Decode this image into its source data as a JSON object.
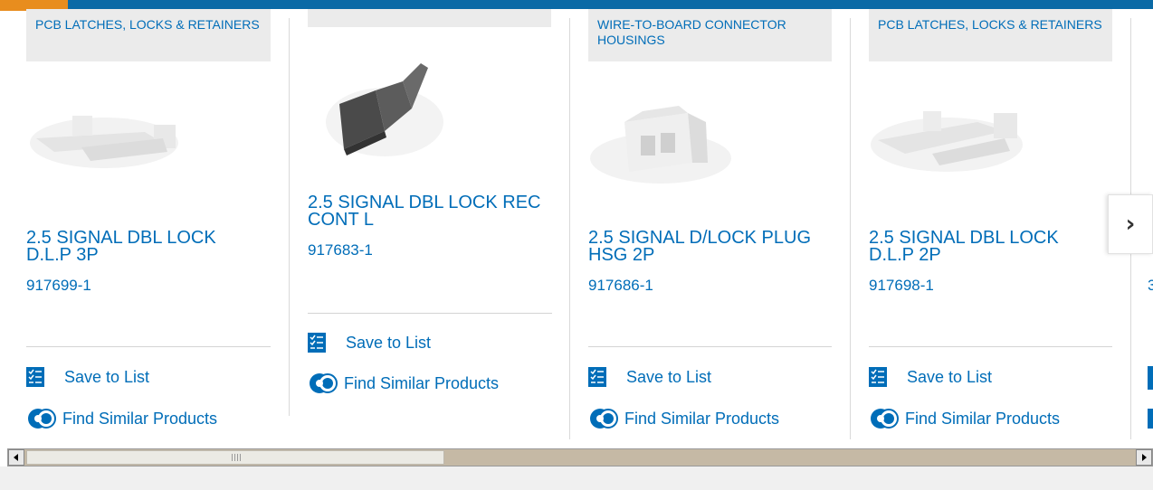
{
  "cards": [
    {
      "category": "PCB LATCHES, LOCKS & RETAINERS",
      "title": "2.5 SIGNAL DBL LOCK D.L.P 3P",
      "part_number": "917699-1",
      "save_label": "Save to List",
      "similar_label": "Find Similar Products"
    },
    {
      "category": "",
      "title": "2.5 SIGNAL DBL LOCK REC CONT L",
      "part_number": "917683-1",
      "save_label": "Save to List",
      "similar_label": "Find Similar Products"
    },
    {
      "category": "WIRE-TO-BOARD CONNECTOR HOUSINGS",
      "title": "2.5 SIGNAL D/LOCK PLUG HSG 2P",
      "part_number": "917686-1",
      "save_label": "Save to List",
      "similar_label": "Find Similar Products"
    },
    {
      "category": "PCB LATCHES, LOCKS & RETAINERS",
      "title": "2.5 SIGNAL DBL LOCK D.L.P 2P",
      "part_number": "917698-1",
      "save_label": "Save to List",
      "similar_label": "Find Similar Products"
    }
  ],
  "partial_card": {
    "part_number_fragment": "3"
  },
  "carousel": {
    "next_symbol": "›"
  },
  "scrollbar": {
    "scroll_fraction": 0.0
  },
  "colors": {
    "brand_blue": "#006db8",
    "accent_orange": "#e88d1e",
    "top_bar": "#0a6aa6"
  }
}
